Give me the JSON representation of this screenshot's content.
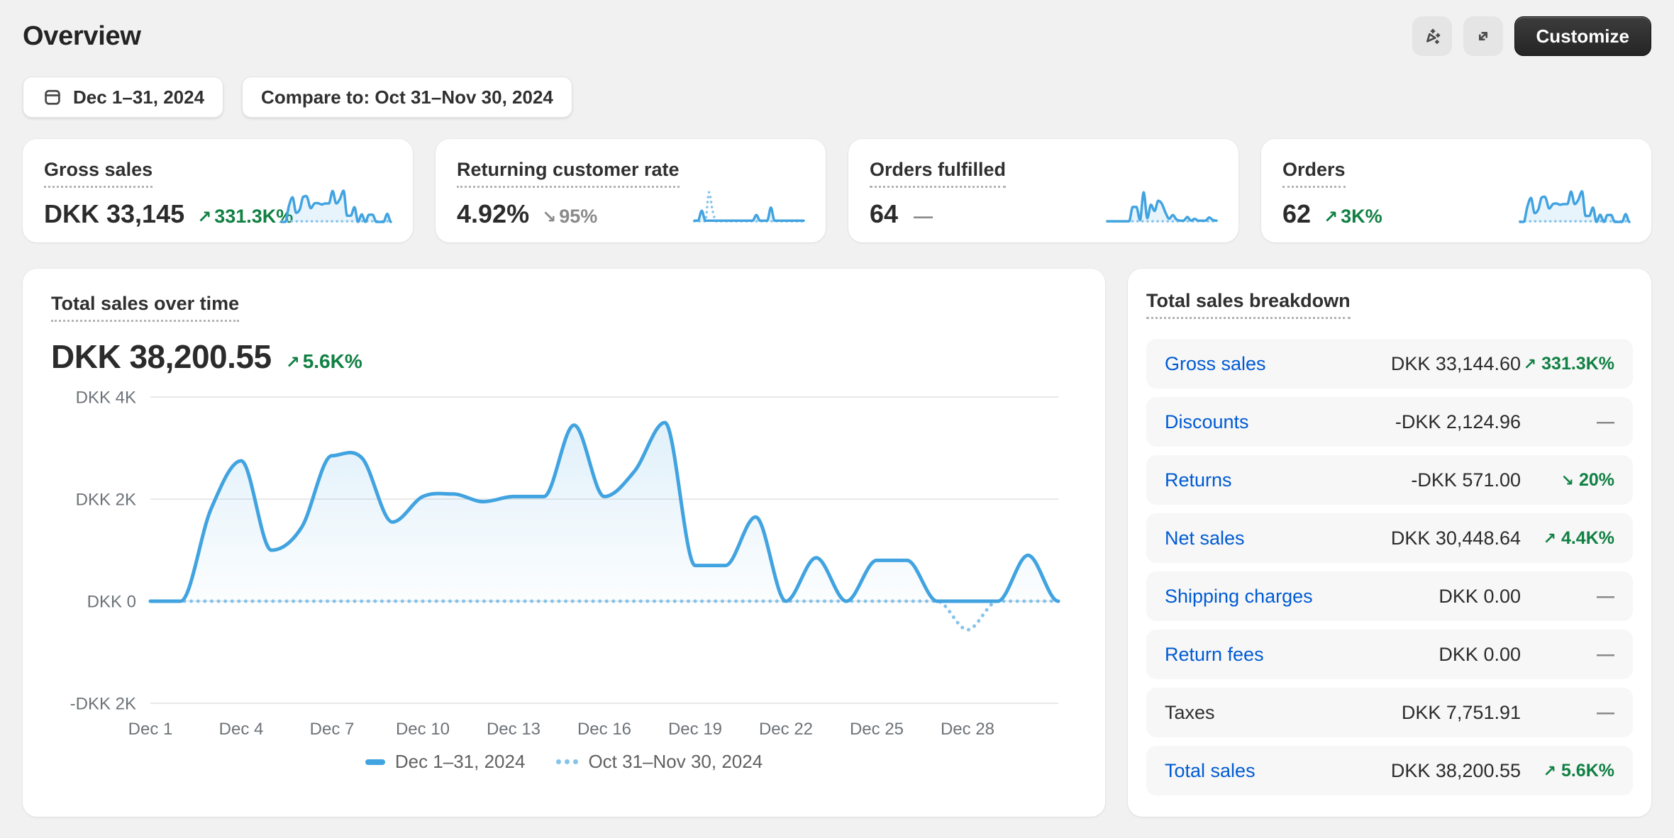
{
  "header": {
    "title": "Overview",
    "customize_label": "Customize"
  },
  "filters": {
    "date_range": "Dec 1–31, 2024",
    "compare": "Compare to: Oct 31–Nov 30, 2024"
  },
  "colors": {
    "accent_blue": "#41a3e0",
    "compare_blue": "#85c3ea",
    "positive_green": "#108043",
    "muted_gray": "#8a8a8a",
    "link_blue": "#005BD3",
    "grid": "#e9e9e9",
    "axis_text": "#6e7378",
    "area_top": "rgba(65,163,224,0.16)",
    "area_bottom": "rgba(65,163,224,0.02)",
    "spark_fill": "rgba(65,163,224,0.12)"
  },
  "metrics": [
    {
      "label": "Gross sales",
      "value": "DKK 33,145",
      "arrow": "↗",
      "delta": "331.3K%",
      "tone": "positive"
    },
    {
      "label": "Returning customer rate",
      "value": "4.92%",
      "arrow": "↘",
      "delta": "95%",
      "tone": "muted"
    },
    {
      "label": "Orders fulfilled",
      "value": "64",
      "arrow": "",
      "delta": "—",
      "tone": "muted"
    },
    {
      "label": "Orders",
      "value": "62",
      "arrow": "↗",
      "delta": "3K%",
      "tone": "positive"
    }
  ],
  "main_chart": {
    "title": "Total sales over time",
    "value": "DKK 38,200.55",
    "arrow": "↗",
    "delta": "5.6K%",
    "tone": "positive"
  },
  "legend": [
    {
      "label": "Dec 1–31, 2024",
      "style": "solid"
    },
    {
      "label": "Oct 31–Nov 30, 2024",
      "style": "dotted"
    }
  ],
  "breakdown": {
    "title": "Total sales breakdown",
    "rows": [
      {
        "label": "Gross sales",
        "link": true,
        "value": "DKK 33,144.60",
        "arrow": "↗",
        "delta": "331.3K%",
        "tone": "positive"
      },
      {
        "label": "Discounts",
        "link": true,
        "value": "-DKK 2,124.96",
        "arrow": "",
        "delta": "—",
        "tone": "muted"
      },
      {
        "label": "Returns",
        "link": true,
        "value": "-DKK 571.00",
        "arrow": "↘",
        "delta": "20%",
        "tone": "positive"
      },
      {
        "label": "Net sales",
        "link": true,
        "value": "DKK 30,448.64",
        "arrow": "↗",
        "delta": "4.4K%",
        "tone": "positive"
      },
      {
        "label": "Shipping charges",
        "link": true,
        "value": "DKK 0.00",
        "arrow": "",
        "delta": "—",
        "tone": "muted"
      },
      {
        "label": "Return fees",
        "link": true,
        "value": "DKK 0.00",
        "arrow": "",
        "delta": "—",
        "tone": "muted"
      },
      {
        "label": "Taxes",
        "link": false,
        "value": "DKK 7,751.91",
        "arrow": "",
        "delta": "—",
        "tone": "muted"
      },
      {
        "label": "Total sales",
        "link": true,
        "value": "DKK 38,200.55",
        "arrow": "↗",
        "delta": "5.6K%",
        "tone": "positive"
      }
    ]
  },
  "chart_data": [
    {
      "id": "total-sales-over-time",
      "type": "area",
      "title": "Total sales over time",
      "ylabel": "DKK",
      "days": 31,
      "ylim": [
        -2300,
        4300
      ],
      "grid": true,
      "legend_position": "bottom-center",
      "y_ticks": [
        {
          "value": 4000,
          "label": "DKK 4K"
        },
        {
          "value": 2000,
          "label": "DKK 2K"
        },
        {
          "value": 0,
          "label": "DKK 0"
        },
        {
          "value": -2000,
          "label": "-DKK 2K"
        }
      ],
      "x_ticks": [
        {
          "day": 1,
          "label": "Dec 1"
        },
        {
          "day": 4,
          "label": "Dec 4"
        },
        {
          "day": 7,
          "label": "Dec 7"
        },
        {
          "day": 10,
          "label": "Dec 10"
        },
        {
          "day": 13,
          "label": "Dec 13"
        },
        {
          "day": 16,
          "label": "Dec 16"
        },
        {
          "day": 19,
          "label": "Dec 19"
        },
        {
          "day": 22,
          "label": "Dec 22"
        },
        {
          "day": 25,
          "label": "Dec 25"
        },
        {
          "day": 28,
          "label": "Dec 28"
        }
      ],
      "series": [
        {
          "name": "Dec 1–31, 2024",
          "style": "solid",
          "values": [
            0,
            0,
            1800,
            2750,
            1000,
            1450,
            2850,
            2800,
            1550,
            2050,
            2100,
            1950,
            2050,
            2050,
            3450,
            2050,
            2550,
            3500,
            700,
            700,
            1650,
            0,
            850,
            0,
            800,
            800,
            0,
            0,
            0,
            900,
            0
          ]
        },
        {
          "name": "Oct 31–Nov 30, 2024",
          "style": "dotted",
          "values": [
            0,
            0,
            0,
            0,
            0,
            0,
            0,
            0,
            0,
            0,
            0,
            0,
            0,
            0,
            0,
            0,
            0,
            0,
            0,
            0,
            0,
            0,
            0,
            0,
            0,
            0,
            0,
            -560,
            0,
            0,
            0
          ]
        }
      ]
    },
    {
      "id": "spark-gross-sales",
      "type": "sparkline",
      "metric": "Gross sales",
      "values": [
        0,
        0,
        51,
        79,
        29,
        41,
        81,
        80,
        44,
        59,
        60,
        56,
        59,
        59,
        99,
        59,
        73,
        100,
        20,
        20,
        47,
        0,
        24,
        0,
        23,
        23,
        0,
        0,
        0,
        26,
        0
      ],
      "compare": [
        2,
        2,
        2,
        2,
        2,
        2,
        2,
        2,
        2,
        2,
        2,
        2,
        2,
        2,
        2,
        2,
        2,
        2,
        2,
        2,
        2,
        2,
        2,
        2,
        2,
        2,
        2,
        2,
        2,
        2,
        2
      ]
    },
    {
      "id": "spark-returning-customer-rate",
      "type": "sparkline",
      "metric": "Returning customer rate",
      "values": [
        4,
        4,
        36,
        4,
        4,
        4,
        4,
        4,
        4,
        4,
        4,
        4,
        4,
        4,
        4,
        4,
        4,
        22,
        4,
        4,
        4,
        46,
        4,
        4,
        4,
        4,
        4,
        4,
        4,
        4,
        4
      ],
      "compare": [
        2,
        2,
        2,
        2,
        95,
        35,
        2,
        2,
        2,
        2,
        2,
        2,
        2,
        2,
        2,
        2,
        2,
        2,
        2,
        2,
        2,
        2,
        2,
        2,
        2,
        2,
        2,
        2,
        2,
        2,
        2
      ]
    },
    {
      "id": "spark-orders-fulfilled",
      "type": "sparkline",
      "metric": "Orders fulfilled",
      "values": [
        2,
        2,
        2,
        2,
        2,
        2,
        2,
        48,
        48,
        6,
        95,
        12,
        55,
        35,
        68,
        58,
        30,
        10,
        22,
        8,
        4,
        4,
        16,
        4,
        10,
        4,
        4,
        4,
        14,
        6,
        4
      ],
      "compare": [
        2,
        2,
        2,
        2,
        2,
        2,
        2,
        2,
        2,
        2,
        2,
        2,
        2,
        2,
        2,
        2,
        2,
        2,
        2,
        2,
        2,
        2,
        2,
        2,
        2,
        2,
        2,
        2,
        2,
        2,
        2
      ]
    },
    {
      "id": "spark-orders",
      "type": "sparkline",
      "metric": "Orders",
      "values": [
        0,
        0,
        49,
        77,
        28,
        40,
        79,
        78,
        43,
        57,
        59,
        55,
        57,
        57,
        97,
        57,
        71,
        98,
        19,
        19,
        46,
        0,
        23,
        0,
        22,
        22,
        0,
        0,
        0,
        25,
        0
      ],
      "compare": [
        2,
        2,
        2,
        2,
        2,
        2,
        2,
        2,
        2,
        2,
        2,
        2,
        2,
        2,
        2,
        2,
        2,
        2,
        2,
        2,
        2,
        2,
        2,
        2,
        2,
        2,
        2,
        2,
        2,
        2,
        2
      ]
    }
  ]
}
